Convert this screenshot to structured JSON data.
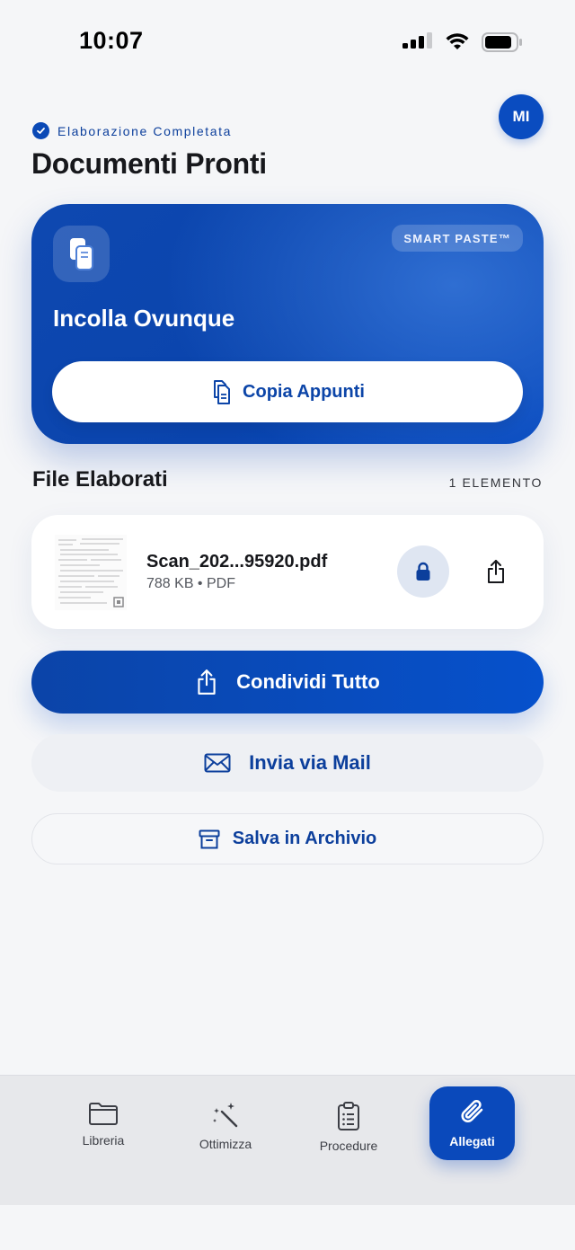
{
  "status_bar": {
    "time": "10:07"
  },
  "header": {
    "status_text": "Elaborazione Completata",
    "title": "Documenti Pronti",
    "avatar_initials": "MI"
  },
  "hero": {
    "badge": "SMART PASTE™",
    "title": "Incolla Ovunque",
    "button_label": "Copia Appunti",
    "icon": "copy-documents-icon"
  },
  "files_section": {
    "title": "File Elaborati",
    "count": "1 ELEMENTO",
    "items": [
      {
        "name": "Scan_202...95920.pdf",
        "meta": "788 KB • PDF"
      }
    ]
  },
  "actions": {
    "share_all": "Condividi Tutto",
    "mail": "Invia via Mail",
    "archive": "Salva in Archivio"
  },
  "tab_bar": {
    "tabs": [
      {
        "label": "Libreria",
        "icon": "folder-icon"
      },
      {
        "label": "Ottimizza",
        "icon": "magic-wand-icon"
      },
      {
        "label": "Procedure",
        "icon": "clipboard-list-icon"
      },
      {
        "label": "Allegati",
        "icon": "paperclip-icon",
        "active": true
      }
    ]
  },
  "colors": {
    "accent": "#0a49bb",
    "background": "#f5f6f8",
    "text_accent": "#0c3f9c"
  }
}
